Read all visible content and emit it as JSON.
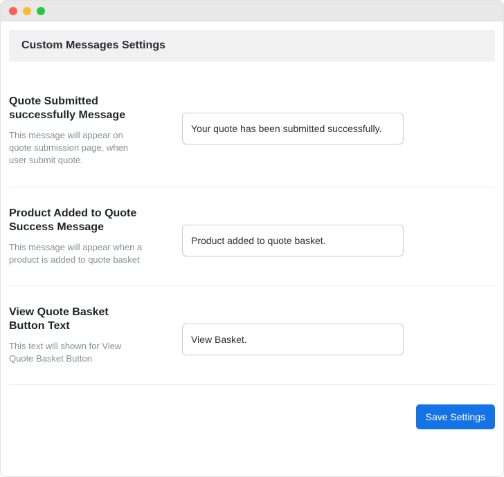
{
  "header": {
    "title": "Custom Messages Settings"
  },
  "settings": [
    {
      "title": "Quote Submitted successfully Message",
      "description": "This message will appear on quote submission page, when user submit quote.",
      "value": "Your quote has been submitted successfully."
    },
    {
      "title": "Product Added to Quote Success Message",
      "description": "This message will appear when a product is added to quote basket",
      "value": "Product added to quote basket."
    },
    {
      "title": "View Quote Basket Button Text",
      "description": "This text will shown for View Quote Basket Button",
      "value": "View Basket."
    }
  ],
  "footer": {
    "save_label": "Save Settings"
  }
}
